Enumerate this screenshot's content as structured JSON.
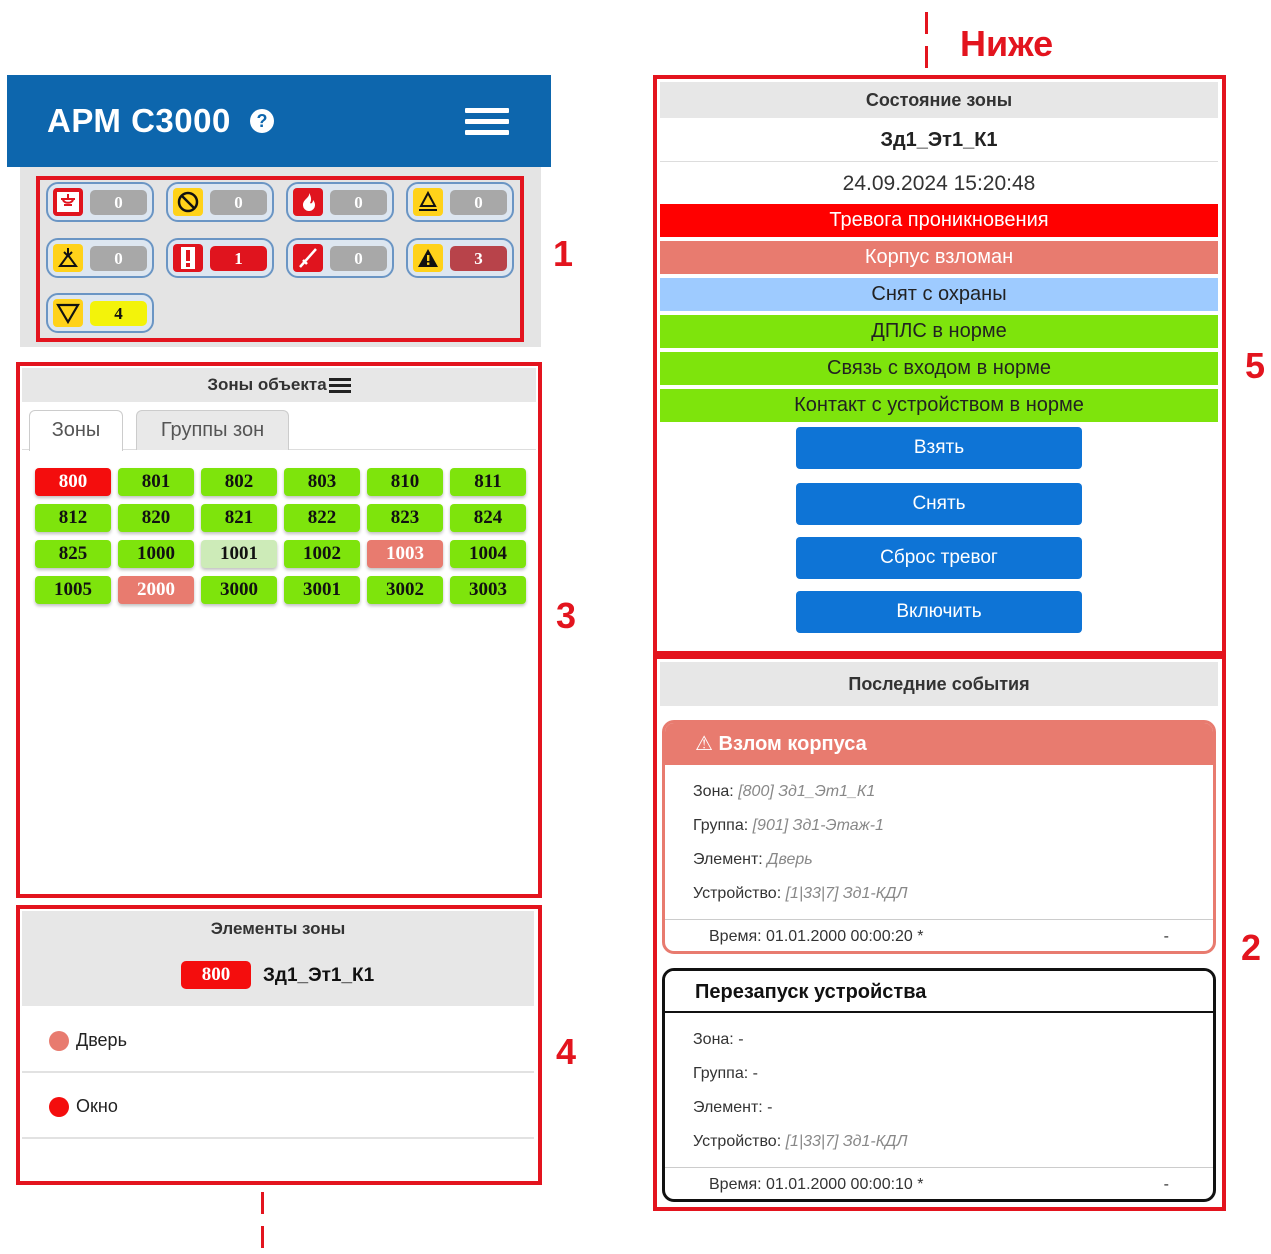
{
  "annotation": {
    "below": "Ниже",
    "labels": [
      "1",
      "2",
      "3",
      "4",
      "5"
    ]
  },
  "header": {
    "title": "АРМ С3000",
    "help": "?"
  },
  "counters": [
    {
      "icon": "fire-alarm-icon",
      "value": "0",
      "num_color": "#a8a8a8"
    },
    {
      "icon": "prohibited-icon",
      "value": "0",
      "num_color": "#a8a8a8"
    },
    {
      "icon": "flame-icon",
      "value": "0",
      "num_color": "#a8a8a8"
    },
    {
      "icon": "warning-underline-icon",
      "value": "0",
      "num_color": "#a8a8a8"
    },
    {
      "icon": "arrow-warning-icon",
      "value": "0",
      "num_color": "#a8a8a8"
    },
    {
      "icon": "exclamation-icon",
      "value": "1",
      "num_color": "#e0141e"
    },
    {
      "icon": "broken-sensor-icon",
      "value": "0",
      "num_color": "#a8a8a8"
    },
    {
      "icon": "warning-triangle-icon",
      "value": "3",
      "num_color": "#b8434a"
    },
    {
      "icon": "down-triangle-icon",
      "value": "4",
      "num_color": "#f3f30a"
    }
  ],
  "zones_panel": {
    "title": "Зоны объекта",
    "tabs": [
      "Зоны",
      "Группы зон"
    ],
    "zones": [
      {
        "id": "800",
        "color": "#f40d0d",
        "text": "#ffffff"
      },
      {
        "id": "801",
        "color": "#7ee40c",
        "text": "#111111"
      },
      {
        "id": "802",
        "color": "#7ee40c",
        "text": "#111111"
      },
      {
        "id": "803",
        "color": "#7ee40c",
        "text": "#111111"
      },
      {
        "id": "810",
        "color": "#7ee40c",
        "text": "#111111"
      },
      {
        "id": "811",
        "color": "#7ee40c",
        "text": "#111111"
      },
      {
        "id": "812",
        "color": "#7ee40c",
        "text": "#111111"
      },
      {
        "id": "820",
        "color": "#7ee40c",
        "text": "#111111"
      },
      {
        "id": "821",
        "color": "#7ee40c",
        "text": "#111111"
      },
      {
        "id": "822",
        "color": "#7ee40c",
        "text": "#111111"
      },
      {
        "id": "823",
        "color": "#7ee40c",
        "text": "#111111"
      },
      {
        "id": "824",
        "color": "#7ee40c",
        "text": "#111111"
      },
      {
        "id": "825",
        "color": "#7ee40c",
        "text": "#111111"
      },
      {
        "id": "1000",
        "color": "#7ee40c",
        "text": "#111111"
      },
      {
        "id": "1001",
        "color": "#cdebb8",
        "text": "#111111"
      },
      {
        "id": "1002",
        "color": "#7ee40c",
        "text": "#111111"
      },
      {
        "id": "1003",
        "color": "#e87b6f",
        "text": "#ffffff"
      },
      {
        "id": "1004",
        "color": "#7ee40c",
        "text": "#111111"
      },
      {
        "id": "1005",
        "color": "#7ee40c",
        "text": "#111111"
      },
      {
        "id": "2000",
        "color": "#e87b6f",
        "text": "#ffffff"
      },
      {
        "id": "3000",
        "color": "#7ee40c",
        "text": "#111111"
      },
      {
        "id": "3001",
        "color": "#7ee40c",
        "text": "#111111"
      },
      {
        "id": "3002",
        "color": "#7ee40c",
        "text": "#111111"
      },
      {
        "id": "3003",
        "color": "#7ee40c",
        "text": "#111111"
      }
    ]
  },
  "elements_panel": {
    "title": "Элементы зоны",
    "zone_badge": "800",
    "zone_name": "Зд1_Эт1_К1",
    "items": [
      {
        "label": "Дверь",
        "color": "#e87b6f"
      },
      {
        "label": "Окно",
        "color": "#f40d0d"
      }
    ]
  },
  "zone_state": {
    "title": "Состояние зоны",
    "name": "Зд1_Эт1_К1",
    "datetime": "24.09.2024 15:20:48",
    "statuses": [
      {
        "text": "Тревога проникновения",
        "bg": "#ff0000",
        "fg": "#ffffff"
      },
      {
        "text": "Корпус взломан",
        "bg": "#e87b6f",
        "fg": "#ffffff"
      },
      {
        "text": "Снят с охраны",
        "bg": "#9ecbff",
        "fg": "#222222"
      },
      {
        "text": "ДПЛС в норме",
        "bg": "#7ee40c",
        "fg": "#222222"
      },
      {
        "text": "Связь с входом в норме",
        "bg": "#7ee40c",
        "fg": "#222222"
      },
      {
        "text": "Контакт с устройством в норме",
        "bg": "#7ee40c",
        "fg": "#222222"
      }
    ],
    "buttons": [
      "Взять",
      "Снять",
      "Сброс тревог",
      "Включить"
    ]
  },
  "events_panel": {
    "title": "Последние события",
    "events": [
      {
        "title": "Взлом корпуса",
        "head_bg": "#e87b6f",
        "head_fg": "#ffffff",
        "border": "#e87b6f",
        "zone_label": "Зона:",
        "zone": "[800] Зд1_Эт1_К1",
        "group_label": "Группа:",
        "group": "[901] Зд1-Этаж-1",
        "element_label": "Элемент:",
        "element": "Дверь",
        "device_label": "Устройство:",
        "device": "[1|33|7] Зд1-КДЛ",
        "time": "Время: 01.01.2000 00:00:20 *",
        "dash": "-"
      },
      {
        "title": "Перезапуск устройства",
        "head_bg": "#ffffff",
        "head_fg": "#111111",
        "border": "#111111",
        "zone_label": "Зона:",
        "zone": "-",
        "group_label": "Группа:",
        "group": "-",
        "element_label": "Элемент:",
        "element": "-",
        "device_label": "Устройство:",
        "device": "[1|33|7] Зд1-КДЛ",
        "time": "Время: 01.01.2000 00:00:10 *",
        "dash": "-"
      }
    ]
  }
}
